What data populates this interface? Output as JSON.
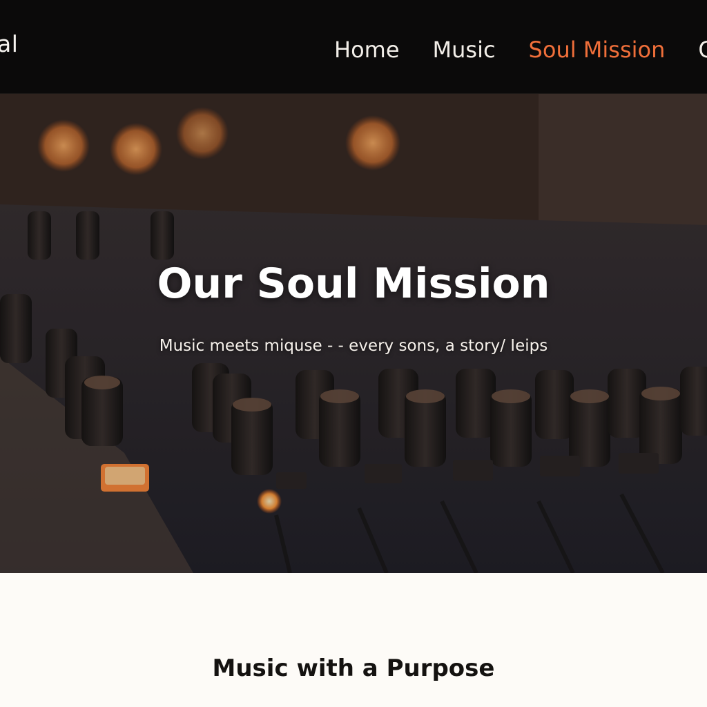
{
  "header": {
    "brand": "al",
    "nav": [
      {
        "label": "Home",
        "active": false
      },
      {
        "label": "Music",
        "active": false
      },
      {
        "label": "Soul Mission",
        "active": true
      },
      {
        "label": "C",
        "active": false
      }
    ],
    "accent_color": "#f06f3a"
  },
  "hero": {
    "title": "Our Soul Mission",
    "subtitle": "Music meets miquse - - every sons, a story/ Ⅰeips",
    "background_image": "audio mixing console with knobs and faders, warm bokeh lights"
  },
  "section": {
    "title": "Music with a Purpose"
  }
}
